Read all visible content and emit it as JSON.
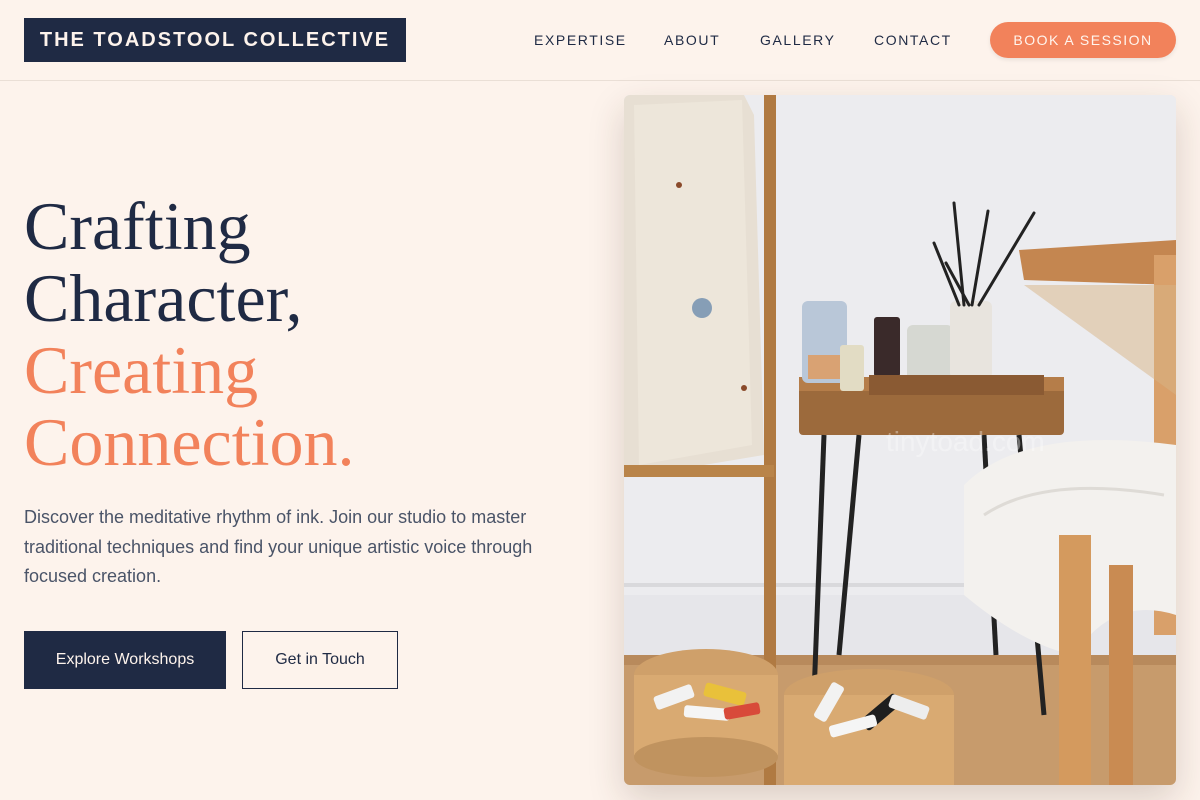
{
  "header": {
    "logo": "THE TOADSTOOL COLLECTIVE",
    "nav": [
      {
        "label": "EXPERTISE"
      },
      {
        "label": "ABOUT"
      },
      {
        "label": "GALLERY"
      },
      {
        "label": "CONTACT"
      }
    ],
    "cta": "BOOK A SESSION"
  },
  "hero": {
    "headline_line1": "Crafting",
    "headline_line2": "Character,",
    "headline_line3": "Creating",
    "headline_line4": "Connection.",
    "description": "Discover the meditative rhythm of ink. Join our studio to master traditional techniques and find your unique artistic voice through focused creation.",
    "primary_button": "Explore Workshops",
    "secondary_button": "Get in Touch"
  },
  "photo": {
    "subject": "art studio with paint brushes, jars, stool and tubes of paint",
    "watermark": "tinytoad.com"
  },
  "colors": {
    "background": "#fdf3ec",
    "navy": "#1f2a44",
    "accent": "#f2825b"
  }
}
